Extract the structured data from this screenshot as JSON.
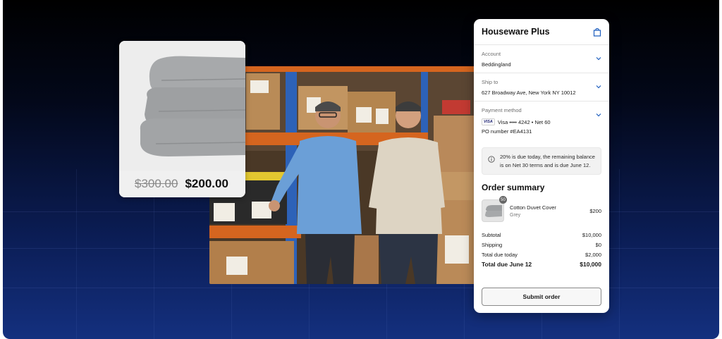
{
  "product": {
    "old_price": "$300.00",
    "new_price": "$200.00"
  },
  "checkout": {
    "store_name": "Houseware Plus",
    "account": {
      "label": "Account",
      "value": "Beddingland"
    },
    "ship_to": {
      "label": "Ship to",
      "value": "627 Broadway Ave, New York NY 10012"
    },
    "payment": {
      "label": "Payment method",
      "card_brand": "VISA",
      "card_text": "Visa •••• 4242 • Net 60",
      "po_number": "PO number #EA4131"
    },
    "notice": "20% is due today, the remaining balance is on Net 30 terms and is due June 12.",
    "summary_title": "Order summary",
    "item": {
      "name": "Cotton Duvet Cover",
      "variant": "Grey",
      "price": "$200",
      "quantity": "50"
    },
    "totals": {
      "subtotal_label": "Subtotal",
      "subtotal": "$10,000",
      "shipping_label": "Shipping",
      "shipping": "$0",
      "due_today_label": "Total due today",
      "due_today": "$2,000",
      "due_june_label": "Total due June 12",
      "due_june": "$10,000"
    },
    "submit_label": "Submit order"
  },
  "colors": {
    "accent": "#1f5fbf",
    "background_top": "#000000",
    "background_bottom": "#14307f"
  },
  "icons": [
    "shopping-bag-icon",
    "chevron-down-icon",
    "info-icon"
  ]
}
